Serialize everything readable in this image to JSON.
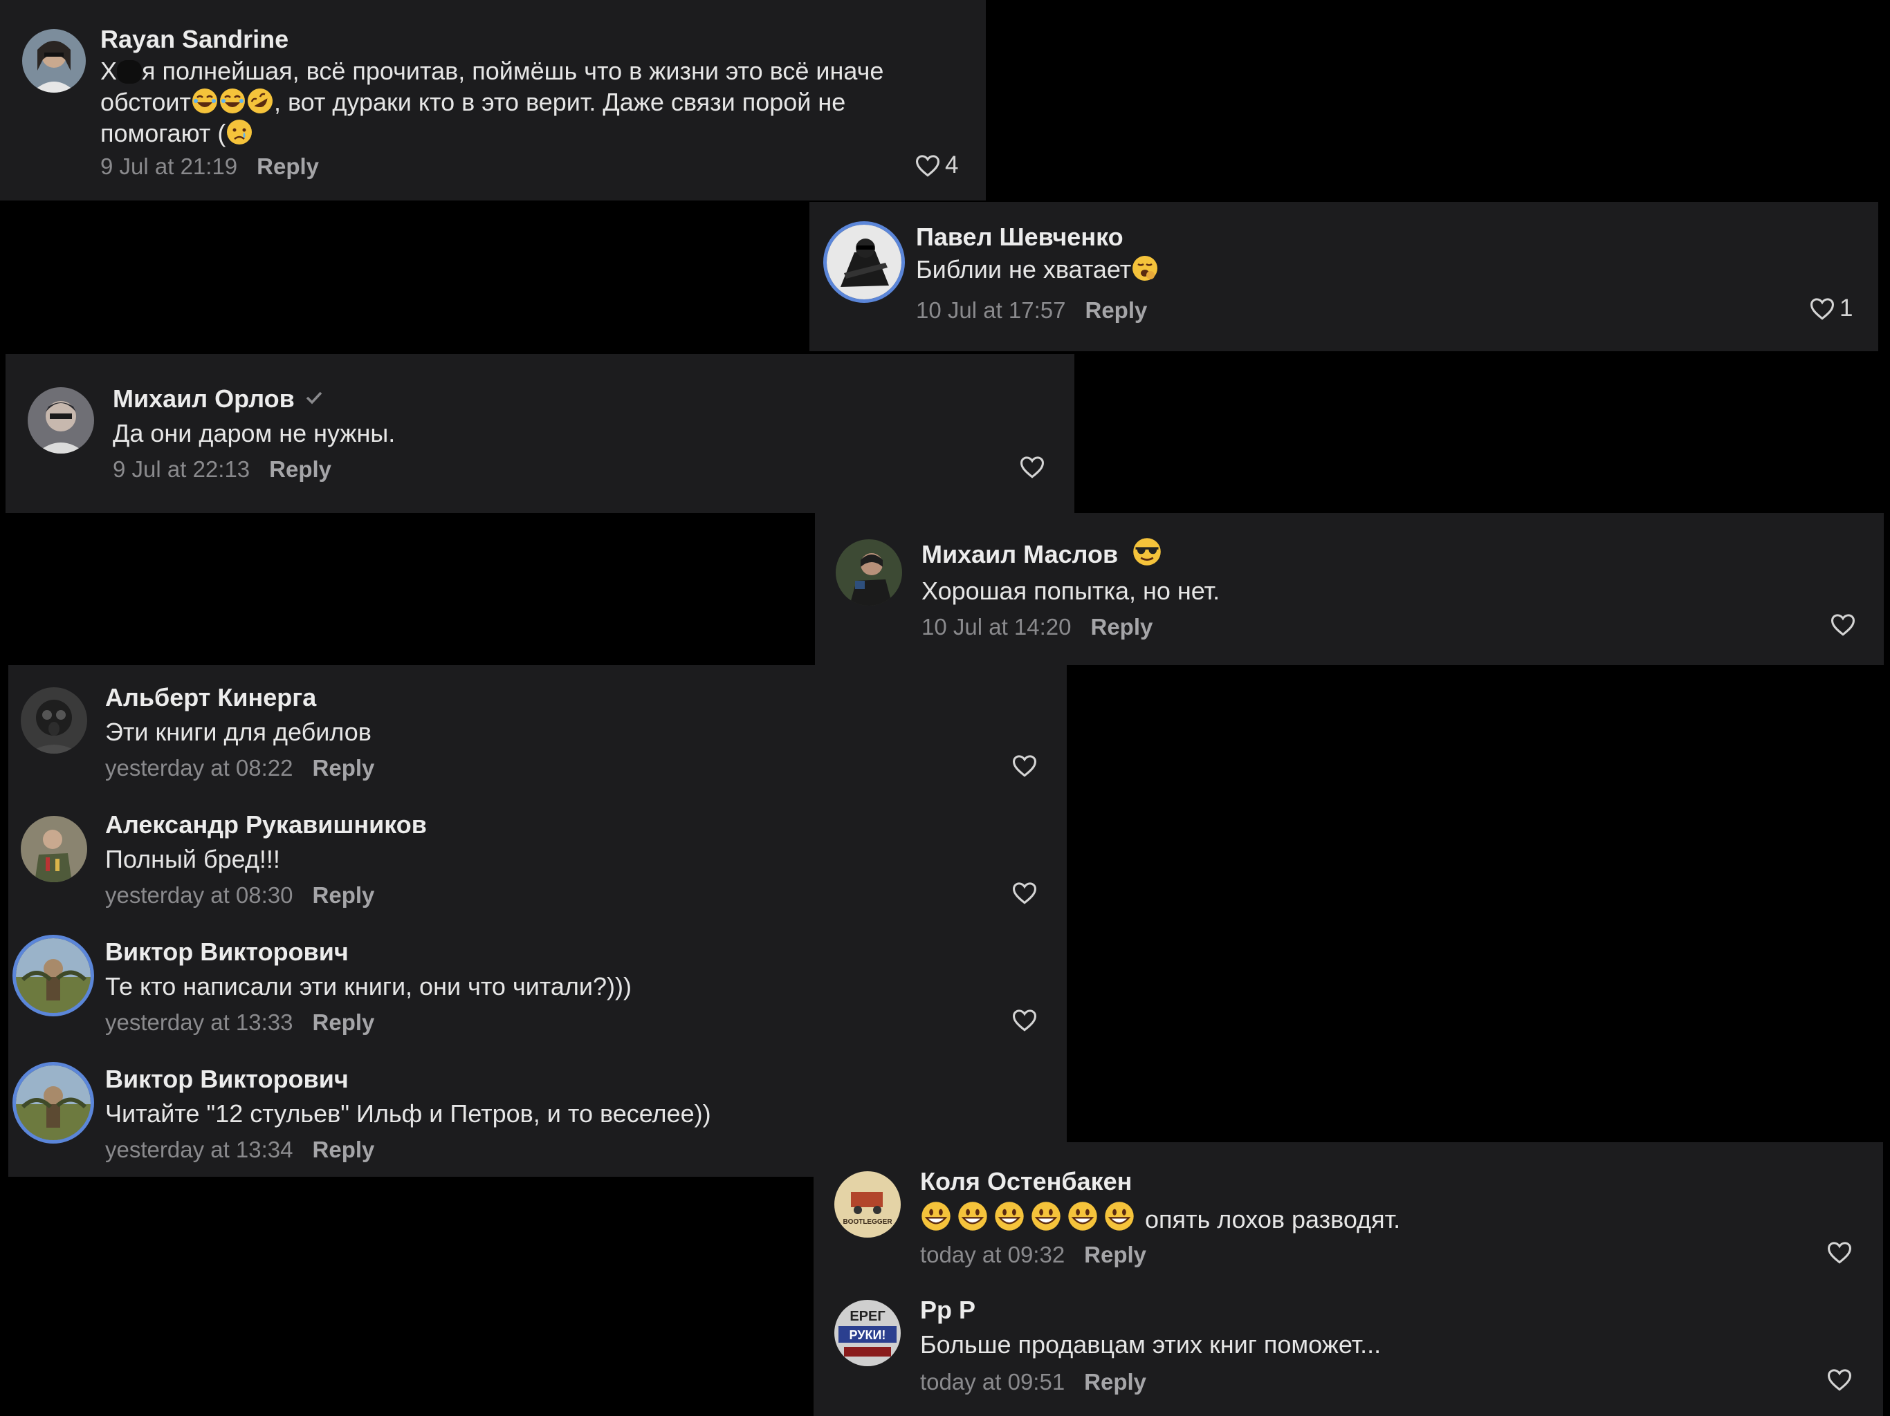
{
  "comments": [
    {
      "name": "Rayan Sandrine",
      "text_part1": "Х",
      "text_part2": "я полнейшая, всё прочитав, поймёшь что в жизни это всё иначе",
      "text_line2_a": "обстоит",
      "text_line2_b": ", вот дураки кто в это верит. Даже связи порой не",
      "text_line3": "помогают (",
      "time": "9 Jul at 21:19",
      "reply": "Reply",
      "likes": "4"
    },
    {
      "name": "Павел Шевченко",
      "text": "Библии не хватает",
      "time": "10 Jul at 17:57",
      "reply": "Reply",
      "likes": "1"
    },
    {
      "name": "Михаил Орлов",
      "text": "Да они даром не нужны.",
      "time": "9 Jul at 22:13",
      "reply": "Reply"
    },
    {
      "name": "Михаил Маслов",
      "text": "Хорошая попытка, но нет.",
      "time": "10 Jul at 14:20",
      "reply": "Reply"
    },
    {
      "name": "Альберт Кинерга",
      "text": "Эти книги для дебилов",
      "time": "yesterday at 08:22",
      "reply": "Reply"
    },
    {
      "name": "Александр Рукавишников",
      "text": "Полный бред!!!",
      "time": "yesterday at 08:30",
      "reply": "Reply"
    },
    {
      "name": "Виктор Викторович",
      "text": "Те кто написали эти книги, они что читали?)))",
      "time": "yesterday at 13:33",
      "reply": "Reply"
    },
    {
      "name": "Виктор Викторович",
      "text": "Читайте \"12 стульев\" Ильф и Петров, и то веселее))",
      "time": "yesterday at 13:34",
      "reply": "Reply"
    },
    {
      "name": "Коля Остенбакен",
      "text": "опять лохов разводят.",
      "time": "today at 09:32",
      "reply": "Reply",
      "avatar_text": "BOOTLEGGER"
    },
    {
      "name": "Рр Р",
      "text": "Больше продавцам этих книг поможет...",
      "time": "today at 09:51",
      "reply": "Reply",
      "avatar_text_top": "ЕРЕГ",
      "avatar_text_mid": "РУКИ!"
    }
  ],
  "colors": {
    "panel": "#1c1c1e",
    "background": "#000000",
    "ring": "#5b86d9",
    "muted": "#8a8a8d"
  },
  "icons": [
    "heart-icon",
    "verified-check-icon",
    "laughing-emoji",
    "rofl-emoji",
    "crying-emoji",
    "yawning-emoji",
    "sunglasses-emoji",
    "grinning-emoji"
  ]
}
